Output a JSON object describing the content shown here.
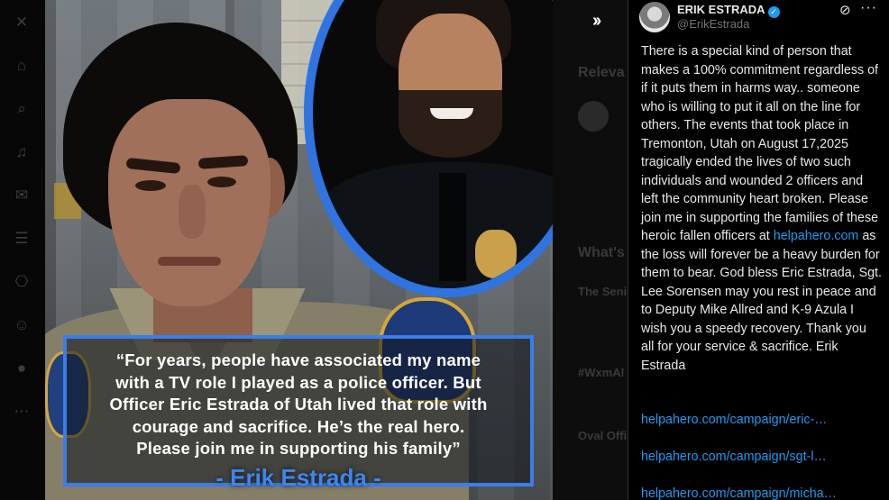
{
  "media": {
    "quote_text": "“For years, people have associated my name\nwith a TV role I played as a police officer. But\nOfficer Eric Estrada of Utah lived that role with\ncourage and sacrifice. He’s the real hero.\nPlease join me in supporting his family”",
    "quote_signature": "- Erik Estrada -"
  },
  "viewer": {
    "expand_icon": "double-chevron-right-icon"
  },
  "background": {
    "relevant_heading": "Releva",
    "whats_heading": "What's",
    "trend1": "The Seni",
    "trend2": "#WxmAl",
    "trend3": "Oval Offi"
  },
  "tweet": {
    "author_name": "ERIK ESTRADA",
    "author_handle": "@ErikEstrada",
    "verified_color": "#1d9bf0",
    "body_part1": "There is a special kind of person that makes a 100% commitment regardless of if it puts them in harms way.. someone who is willing to put it all on the line for others. The events that took place in Tremonton, Utah on August 17,2025 tragically ended the lives of two such individuals and wounded 2 officers and left the community heart broken. Please join me in supporting the families of these heroic fallen officers at ",
    "body_link": "helpahero.com",
    "body_part2": " as the loss will forever be a heavy burden for them to bear. God bless Eric Estrada, Sgt. Lee Sorensen may you rest in peace and to Deputy Mike Allred and K-9 Azula I wish you a speedy recovery. Thank you all for your service & sacrifice.  Erik Estrada",
    "links": [
      "helpahero.com/campaign/eric-…",
      "helpahero.com/campaign/sgt-l…",
      "helpahero.com/campaign/micha…"
    ]
  }
}
